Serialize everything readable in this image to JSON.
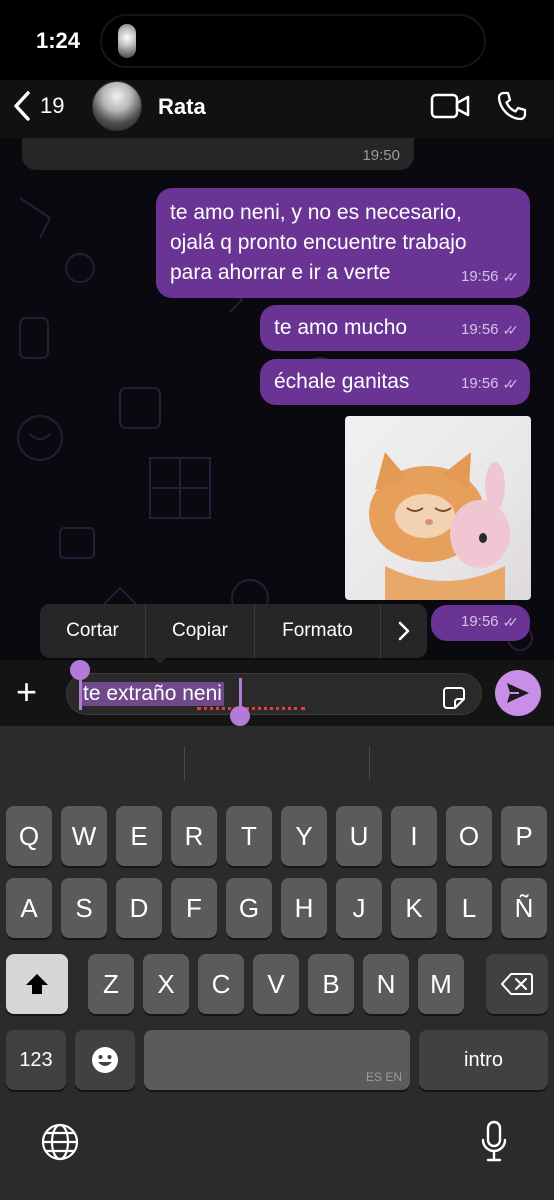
{
  "status_bar": {
    "time": "1:24"
  },
  "header": {
    "back_count": "19",
    "contact_name": "Rata",
    "icons": [
      "chevron-left-icon",
      "video-call-icon",
      "phone-icon"
    ]
  },
  "messages": {
    "incoming_time": "19:50",
    "outgoing": [
      {
        "lines": [
          "te amo neni, y no es necesario,",
          "ojalá q pronto encuentre trabajo",
          "para ahorrar e ir a verte"
        ],
        "time": "19:56",
        "status": "read"
      },
      {
        "lines": [
          "te amo mucho"
        ],
        "time": "19:56",
        "status": "read"
      },
      {
        "lines": [
          "échale ganitas"
        ],
        "time": "19:56",
        "status": "read"
      }
    ],
    "photo_time": "19:56",
    "photo_status": "read"
  },
  "context_menu": {
    "items": [
      "Cortar",
      "Copiar",
      "Formato"
    ]
  },
  "composer": {
    "text": "te extraño neni"
  },
  "keyboard": {
    "row1": [
      "Q",
      "W",
      "E",
      "R",
      "T",
      "Y",
      "U",
      "I",
      "O",
      "P"
    ],
    "row2": [
      "A",
      "S",
      "D",
      "F",
      "G",
      "H",
      "J",
      "K",
      "L",
      "Ñ"
    ],
    "row3": [
      "Z",
      "X",
      "C",
      "V",
      "B",
      "N",
      "M"
    ],
    "numbers_key": "123",
    "return_key": "intro",
    "space_languages": "ES EN"
  },
  "colors": {
    "bubble": "#6a3494",
    "accent": "#c98ee8",
    "background": "#0b0910"
  }
}
